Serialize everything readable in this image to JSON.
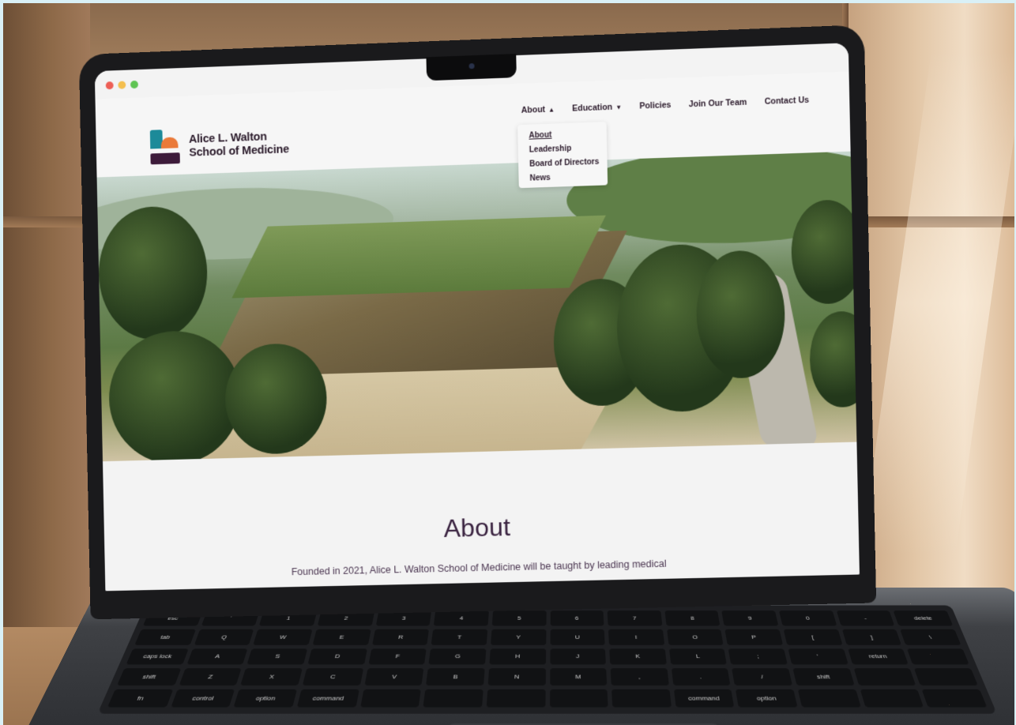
{
  "browser": {
    "traffic_lights": [
      "close",
      "minimize",
      "zoom"
    ]
  },
  "site": {
    "logo": {
      "line1": "Alice L. Walton",
      "line2": "School of Medicine"
    },
    "nav": [
      {
        "label": "About",
        "caret": "▲"
      },
      {
        "label": "Education",
        "caret": "▼"
      },
      {
        "label": "Policies"
      },
      {
        "label": "Join Our Team"
      },
      {
        "label": "Contact Us"
      }
    ],
    "dropdown": [
      {
        "label": "About"
      },
      {
        "label": "Leadership"
      },
      {
        "label": "Board of Directors"
      },
      {
        "label": "News"
      }
    ],
    "page_title": "About",
    "intro": "Founded in 2021, Alice L. Walton School of Medicine will be taught by leading medical"
  },
  "keyboard": {
    "keys": [
      "esc",
      "`",
      "1",
      "2",
      "3",
      "4",
      "5",
      "6",
      "7",
      "8",
      "9",
      "0",
      "-",
      "delete",
      "tab",
      "Q",
      "W",
      "E",
      "R",
      "T",
      "Y",
      "U",
      "I",
      "O",
      "P",
      "[",
      "]",
      "\\",
      "caps lock",
      "A",
      "S",
      "D",
      "F",
      "G",
      "H",
      "J",
      "K",
      "L",
      ";",
      "'",
      "return",
      "",
      "shift",
      "Z",
      "X",
      "C",
      "V",
      "B",
      "N",
      "M",
      ",",
      ".",
      "/",
      "shift",
      "",
      "",
      "fn",
      "control",
      "option",
      "command",
      "",
      "",
      "",
      "",
      "",
      "command",
      "option",
      "",
      "",
      ""
    ]
  },
  "colors": {
    "brand_plum": "#3d1b3a",
    "brand_teal": "#1c8a99",
    "brand_orange": "#ea7a3a"
  }
}
